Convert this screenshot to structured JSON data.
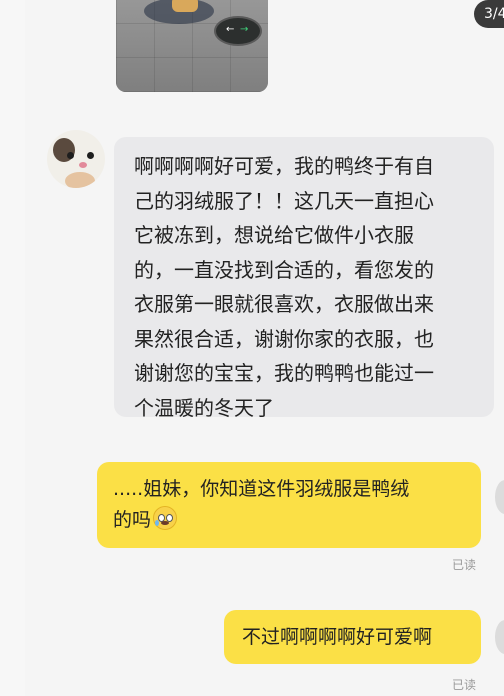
{
  "page_counter": "3/4",
  "incoming_message": {
    "lines": [
      "啊啊啊啊好可爱，我的鸭终于有自",
      "己的羽绒服了！！这几天一直担心",
      "它被冻到，想说给它做件小衣服",
      "的，一直没找到合适的，看您发的",
      "衣服第一眼就很喜欢，衣服做出来",
      "果然很合适，谢谢你家的衣服，也",
      "谢谢您的宝宝，我的鸭鸭也能过一",
      "个温暖的冬天了"
    ]
  },
  "outgoing_messages": [
    {
      "lines": [
        ".....姐妹，你知道这件羽绒服是鸭绒",
        "的吗"
      ],
      "emoji": "anxious-sweat-face-icon",
      "status": "已读"
    },
    {
      "lines": [
        "不过啊啊啊啊好可爱啊"
      ],
      "status": "已读"
    }
  ],
  "colors": {
    "incoming_bubble": "#e9e9eb",
    "outgoing_bubble": "#fbe046",
    "chat_background": "#f5f5f5"
  }
}
